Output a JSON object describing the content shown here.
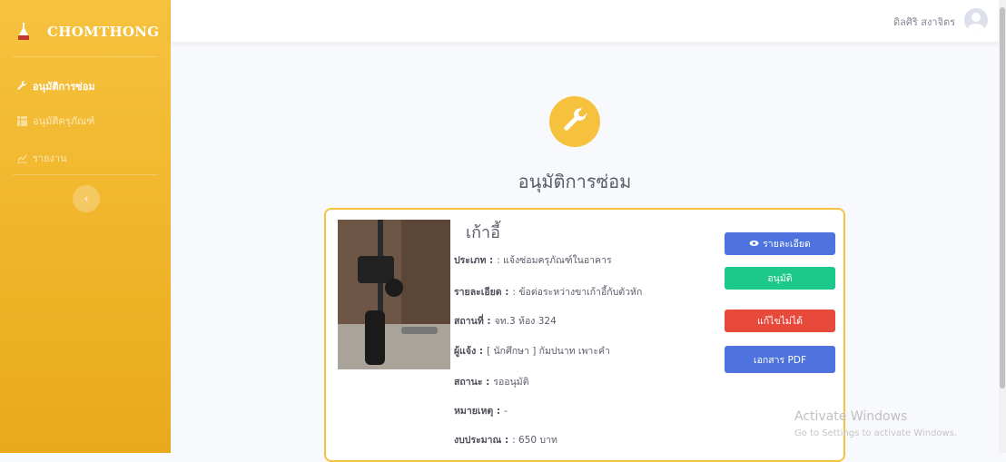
{
  "sidebar": {
    "brand": "CHOMTHONG",
    "items": [
      {
        "label": "อนุมัติการซ่อม",
        "icon": "wrench-icon",
        "active": true
      },
      {
        "label": "อนุมัติครุภัณฑ์",
        "icon": "table-icon",
        "active": false
      },
      {
        "label": "รายงาน",
        "icon": "chart-icon",
        "active": false
      }
    ],
    "toggle_icon": "chevron-left-icon"
  },
  "topbar": {
    "user_name": "ดิลศิริ สงาจิตร",
    "avatar_icon": "user-avatar-icon"
  },
  "main": {
    "title": "อนุมัติการซ่อม",
    "hero_icon": "wrench-icon",
    "card": {
      "item_name": "เก้าอี้",
      "fields": [
        {
          "label": "ประเภท :",
          "value": ": แจ้งซ่อมครุภัณฑ์ในอาคาร"
        },
        {
          "label": "รายละเอียด :",
          "value": ": ข้อต่อระหว่างขาเก้าอี้กับตัวหัก"
        },
        {
          "label": "สถานที่ :",
          "value": "จท.3 ห้อง 324"
        },
        {
          "label": "ผู้แจ้ง :",
          "value": "[ นักศึกษา ] กัมปนาท เพาะคำ"
        },
        {
          "label": "สถานะ :",
          "value": "รออนุมัติ"
        },
        {
          "label": "หมายเหตุ :",
          "value": "-"
        },
        {
          "label": "งบประมาณ :",
          "value": ": 650 บาท"
        }
      ],
      "buttons": {
        "detail": "รายละเอียด",
        "approve": "อนุมัติ",
        "cannot_fix": "แก้ไขไม่ได้",
        "pdf": "เอกสาร PDF"
      }
    }
  },
  "watermark": {
    "title": "Activate Windows",
    "subtitle": "Go to Settings to activate Windows."
  },
  "colors": {
    "sidebar": "#f6c23e",
    "primary": "#4e73df",
    "success": "#1cc88a",
    "danger": "#e74a3b"
  }
}
